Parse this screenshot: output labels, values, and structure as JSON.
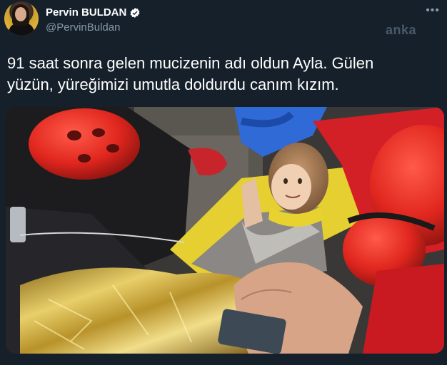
{
  "author": {
    "name": "Pervin BULDAN",
    "handle": "@PervinBuldan",
    "verified": true
  },
  "watermark": "anka",
  "tweet": {
    "text_line1": "91 saat sonra gelen mucizenin adı oldun Ayla. Gülen",
    "text_line2": "yüzün, yüreğimizi umutla doldurdu canım kızım."
  },
  "icons": {
    "verified": "verified-badge-icon",
    "more": "more-options-icon"
  },
  "colors": {
    "background": "#15202b",
    "text": "#ffffff",
    "secondary": "#8899a6",
    "helmet_red": "#e8262b",
    "blanket_gold": "#d9b84a"
  }
}
